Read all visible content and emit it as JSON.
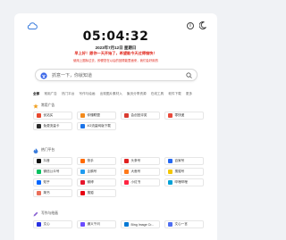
{
  "header": {
    "time": "05:04:32",
    "date": "2023年7月12日 星期日",
    "quote": "早上好！愿你一天开始了，希望能今天过得愉快！",
    "notice": "使用上图标过去，即便您在以后的回顾能里面来，我们会好用的"
  },
  "search": {
    "placeholder": "抓意一下，你就知道"
  },
  "tabs": [
    "全部",
    "常用广告",
    "热门平台",
    "写作与绘画",
    "出现图片素材入",
    "聚页分享资源",
    "在线工具",
    "软件下载",
    "更多"
  ],
  "sections": [
    {
      "title": "常用广告",
      "items": [
        {
          "label": "优站买",
          "color": "#e8482e"
        },
        {
          "label": "你懂联盟",
          "color": "#f28a1c"
        },
        {
          "label": "会创宜评奖",
          "color": "#d93b30"
        },
        {
          "label": "零快递",
          "color": "#e94b3c"
        },
        {
          "label": "免费流量卡",
          "color": "#2b2b2b"
        },
        {
          "label": "4G流量网版下载",
          "color": "#1a73e8"
        }
      ]
    },
    {
      "title": "热门平台",
      "items": [
        {
          "label": "抖音",
          "color": "#111111"
        },
        {
          "label": "快手",
          "color": "#ff6a00"
        },
        {
          "label": "头条号",
          "color": "#e02020"
        },
        {
          "label": "百家号",
          "color": "#2468f2"
        },
        {
          "label": "微信公众号",
          "color": "#07c160"
        },
        {
          "label": "企鹅号",
          "color": "#1e9bf0"
        },
        {
          "label": "大鱼号",
          "color": "#ff7a1a"
        },
        {
          "label": "搜狐号",
          "color": "#f4c600"
        },
        {
          "label": "知乎",
          "color": "#0066ff"
        },
        {
          "label": "微博",
          "color": "#e6162d"
        },
        {
          "label": "小红书",
          "color": "#ff2442"
        },
        {
          "label": "哔哩哔哩",
          "color": "#00a1d6"
        },
        {
          "label": "简书",
          "color": "#ea6f5a"
        },
        {
          "label": "搜狐",
          "color": "#e60012"
        }
      ]
    },
    {
      "title": "写作与绘画",
      "items": [
        {
          "label": "文心",
          "color": "#2932e1"
        },
        {
          "label": "通义千问",
          "color": "#6a4cff"
        },
        {
          "label": "Bing Image Cr...",
          "color": "#0078d4"
        },
        {
          "label": "文心一言",
          "color": "#4e6ef2"
        }
      ]
    }
  ]
}
